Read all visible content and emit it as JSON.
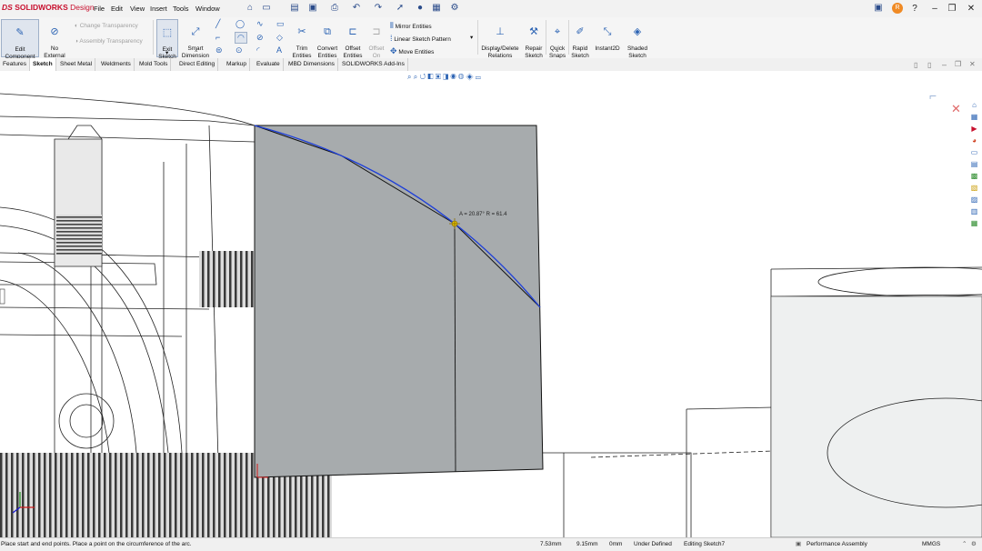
{
  "app": {
    "logo_ds": "DS",
    "logo_name": "SOLIDWORKS",
    "logo_suffix": "Design"
  },
  "menu": [
    "File",
    "Edit",
    "View",
    "Insert",
    "Tools",
    "Window"
  ],
  "user_initial": "R",
  "ribbon": {
    "edit_component": "Edit\nComponent",
    "no_external_references": "No\nExternal\nReferences",
    "change_transparency": "Change Transparency",
    "assembly_transparency": "Assembly Transparency",
    "exit_sketch": "Exit\nSketch",
    "smart_dimension": "Smart\nDimension",
    "trim_entities": "Trim\nEntities",
    "convert_entities": "Convert\nEntities",
    "offset_entities": "Offset\nEntities",
    "offset_on_surface": "Offset\nOn\nSurface",
    "mirror_entities": "Mirror Entities",
    "linear_sketch_pattern": "Linear Sketch Pattern",
    "move_entities": "Move Entities",
    "display_delete_relations": "Display/Delete\nRelations",
    "repair_sketch": "Repair\nSketch",
    "quick_snaps": "Quick\nSnaps",
    "rapid_sketch": "Rapid\nSketch",
    "instant2d": "Instant2D",
    "shaded_sketch_contours": "Shaded\nSketch\nContours"
  },
  "tabs": [
    "Features",
    "Sketch",
    "Sheet Metal",
    "Weldments",
    "Mold Tools",
    "Direct Editing",
    "Markup",
    "Evaluate",
    "MBD Dimensions",
    "SOLIDWORKS Add-Ins"
  ],
  "active_tab": "Sketch",
  "viewport": {
    "arc_readout": "A = 20.87°  R = 61.4"
  },
  "status": {
    "prompt": "Place start and end points. Place a point on the circumference of the arc.",
    "x": "7.53mm",
    "y": "9.15mm",
    "z": "0mm",
    "definition": "Under Defined",
    "editing": "Editing Sketch7",
    "config": "Performance Assembly",
    "units": "MMGS"
  }
}
